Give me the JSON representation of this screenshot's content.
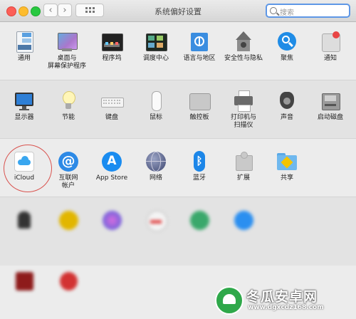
{
  "window": {
    "title": "系统偏好设置"
  },
  "search": {
    "placeholder": "搜索"
  },
  "nav": {
    "back": "‹",
    "forward": "›"
  },
  "row1": [
    {
      "label": "通用"
    },
    {
      "label": "桌面与\n屏幕保护程序"
    },
    {
      "label": "程序坞"
    },
    {
      "label": "调度中心"
    },
    {
      "label": "语言与地区"
    },
    {
      "label": "安全性与隐私"
    },
    {
      "label": "聚焦"
    },
    {
      "label": "通知"
    }
  ],
  "row2": [
    {
      "label": "显示器"
    },
    {
      "label": "节能"
    },
    {
      "label": "键盘"
    },
    {
      "label": "鼠标"
    },
    {
      "label": "触控板"
    },
    {
      "label": "打印机与\n扫描仪"
    },
    {
      "label": "声音"
    },
    {
      "label": "启动磁盘"
    }
  ],
  "row3": [
    {
      "label": "iCloud"
    },
    {
      "label": "互联网\n帐户"
    },
    {
      "label": "App Store"
    },
    {
      "label": "网络"
    },
    {
      "label": "蓝牙"
    },
    {
      "label": "扩展"
    },
    {
      "label": "共享"
    }
  ],
  "watermark": {
    "name": "冬瓜安卓网",
    "url": "www.dgxcdz168.com"
  },
  "colors": {
    "highlight": "#d9534f",
    "search_focus": "#5e97e6"
  }
}
